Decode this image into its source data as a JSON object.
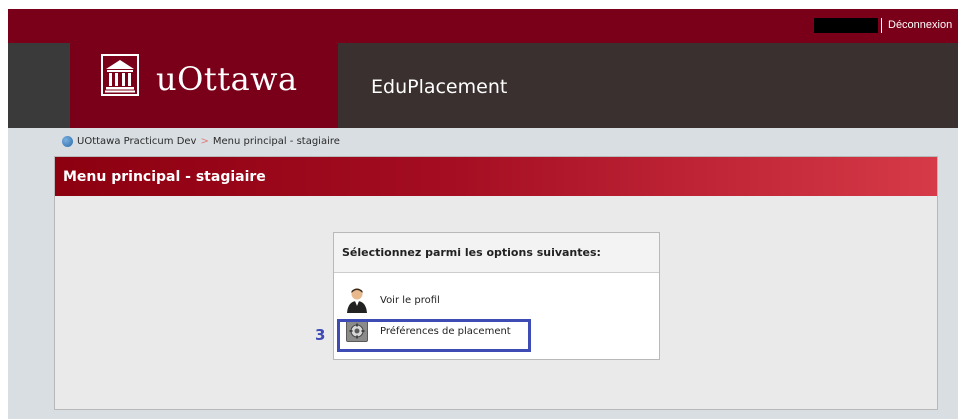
{
  "header": {
    "logout_label": "Déconnexion",
    "logo_text": "uOttawa",
    "app_name": "EduPlacement"
  },
  "breadcrumb": {
    "items": [
      "UOttawa Practicum Dev",
      "Menu principal - stagiaire"
    ],
    "separator": ">"
  },
  "panel": {
    "title": "Menu principal - stagiaire"
  },
  "menu": {
    "heading": "Sélectionnez parmi les options suivantes:",
    "items": [
      {
        "label": "Voir le profil",
        "icon": "person-icon"
      },
      {
        "label": "Préférences de placement",
        "icon": "gear-icon"
      }
    ]
  },
  "annotation": {
    "number": "3",
    "color": "#3f4bb5"
  },
  "colors": {
    "brand_red": "#7a0019",
    "dark_band": "#39302f",
    "content_bg": "#d9dee3"
  }
}
